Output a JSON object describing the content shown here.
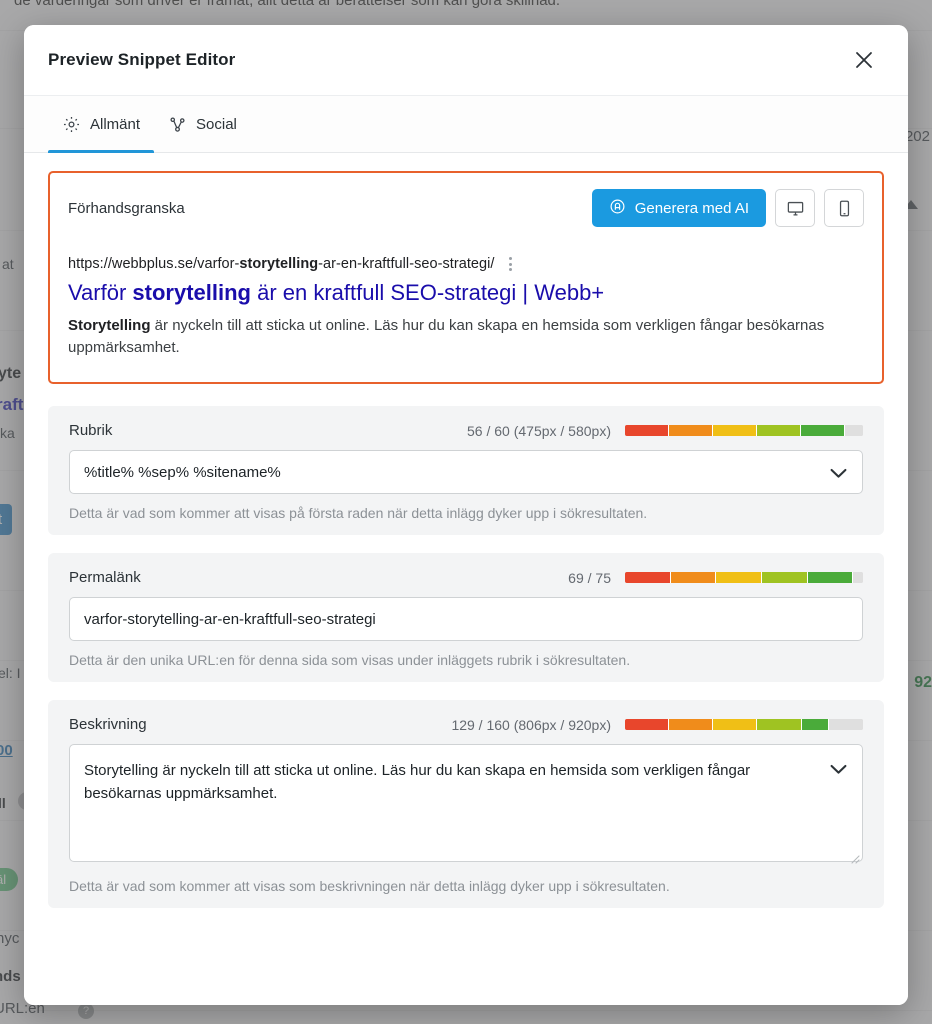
{
  "background": {
    "top_text": "de värderingar som driver er framåt, allt detta är berättelser som kan göra skillnad.",
    "left_fragments": [
      "at",
      "yte",
      "raft",
      "ka",
      "t",
      "el: I",
      "00",
      "ll",
      "äl",
      "nyc",
      "nds",
      "URL:en"
    ],
    "right_fragments": [
      "202",
      "92"
    ]
  },
  "modal": {
    "title": "Preview Snippet Editor",
    "close_label": "✕",
    "tabs": [
      {
        "id": "allmant",
        "label": "Allmänt",
        "icon": "gear-icon",
        "active": true
      },
      {
        "id": "social",
        "label": "Social",
        "icon": "share-nodes-icon",
        "active": false
      }
    ],
    "preview": {
      "label": "Förhandsgranska",
      "ai_button_label": "Generera med AI",
      "ai_button_icon": "ai-sparkle-icon",
      "desktop_button_icon": "desktop-icon",
      "mobile_button_icon": "mobile-icon",
      "url_prefix": "https://webbplus.se/varfor-",
      "url_bold": "storytelling",
      "url_suffix": "-ar-en-kraftfull-seo-strategi/",
      "kebab_icon": "kebab-menu-icon",
      "title_prefix": "Varför ",
      "title_bold": "storytelling",
      "title_suffix": " är en kraftfull SEO-strategi | Webb+",
      "desc_bold": "Storytelling",
      "desc_rest": " är nyckeln till att sticka ut online. Läs hur du kan skapa en hemsida som verkligen fångar besökarnas uppmärksamhet."
    },
    "fields": [
      {
        "id": "rubrik",
        "label": "Rubrik",
        "count": "56 / 60 (475px / 580px)",
        "value": "%title% %sep% %sitename%",
        "hint": "Detta är vad som kommer att visas på första raden när detta inlägg dyker upp i sökresultaten.",
        "type": "input",
        "chevron": "chevron-down-icon"
      },
      {
        "id": "permalank",
        "label": "Permalänk",
        "count": "69 / 75",
        "value": "varfor-storytelling-ar-en-kraftfull-seo-strategi",
        "hint": "Detta är den unika URL:en för denna sida som visas under inläggets rubrik i sökresultaten.",
        "type": "input",
        "chevron": null
      },
      {
        "id": "beskrivning",
        "label": "Beskrivning",
        "count": "129 / 160 (806px / 920px)",
        "value": "Storytelling är nyckeln till att sticka ut online. Läs hur du kan skapa en hemsida som verkligen fångar besökarnas uppmärksamhet.",
        "hint": "Detta är vad som kommer att visas som beskrivningen när detta inlägg dyker upp i sökresultaten.",
        "type": "textarea",
        "chevron": "chevron-down-icon"
      }
    ]
  },
  "colors": {
    "accent_blue": "#1b9ae0",
    "tab_active": "#2196d8",
    "preview_border": "#e8612c",
    "link_blue": "#1a0dab",
    "progress_segments": [
      "#e8462c",
      "#f08c1b",
      "#f0bf16",
      "#9fc322",
      "#4aab3a"
    ],
    "progress_track": "#dfdfdf"
  }
}
